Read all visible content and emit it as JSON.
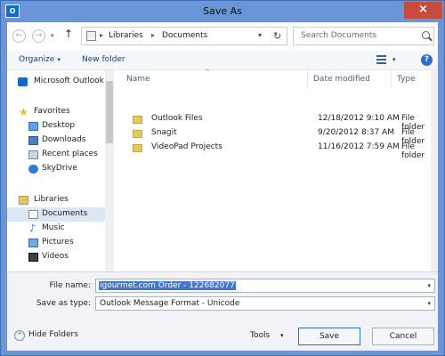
{
  "window": {
    "title": "Save As",
    "app_icon": "O",
    "close_symbol": "×"
  },
  "address": {
    "back_symbol": "←",
    "forward_symbol": "→",
    "up_symbol": "↑",
    "chevron": "▾",
    "path": [
      "Libraries",
      "Documents"
    ],
    "separator": "▸",
    "dropdown_symbol": "▾",
    "refresh_symbol": "↻"
  },
  "search": {
    "placeholder": "Search Documents"
  },
  "toolbar": {
    "organize_label": "Organize",
    "new_folder_label": "New folder",
    "help_symbol": "?",
    "caret": "▾"
  },
  "nav": {
    "items": [
      {
        "label": "Microsoft Outlook",
        "icon": "outlook-icon"
      },
      {
        "label": "Favorites",
        "icon": "star-icon"
      },
      {
        "label": "Desktop",
        "icon": "desktop-icon"
      },
      {
        "label": "Downloads",
        "icon": "downloads-icon"
      },
      {
        "label": "Recent places",
        "icon": "recent-places-icon"
      },
      {
        "label": "SkyDrive",
        "icon": "skydrive-icon"
      },
      {
        "label": "Libraries",
        "icon": "libraries-icon"
      },
      {
        "label": "Documents",
        "icon": "documents-icon"
      },
      {
        "label": "Music",
        "icon": "music-icon"
      },
      {
        "label": "Pictures",
        "icon": "pictures-icon"
      },
      {
        "label": "Videos",
        "icon": "videos-icon"
      }
    ]
  },
  "files": {
    "columns": [
      "Name",
      "Date modified",
      "Type"
    ],
    "rows": [
      {
        "name": "Outlook Files",
        "date": "12/18/2012 9:10 AM",
        "type": "File folder"
      },
      {
        "name": "Snagit",
        "date": "9/20/2012 8:37 AM",
        "type": "File folder"
      },
      {
        "name": "VideoPad Projects",
        "date": "11/16/2012 7:59 AM",
        "type": "File folder"
      }
    ]
  },
  "save": {
    "file_name_label": "File name:",
    "file_name_value": "igourmet.com Order - 122682077",
    "save_type_label": "Save as type:",
    "save_type_value": "Outlook Message Format - Unicode"
  },
  "actions": {
    "hide_folders": "Hide Folders",
    "hide_folders_symbol": "^",
    "tools": "Tools",
    "save": "Save",
    "cancel": "Cancel"
  },
  "colors": {
    "titlebar": "#6b95d6",
    "close_button": "#c74b3f",
    "selection": "#3f78d0",
    "selected_nav": "#dbe7f5"
  }
}
